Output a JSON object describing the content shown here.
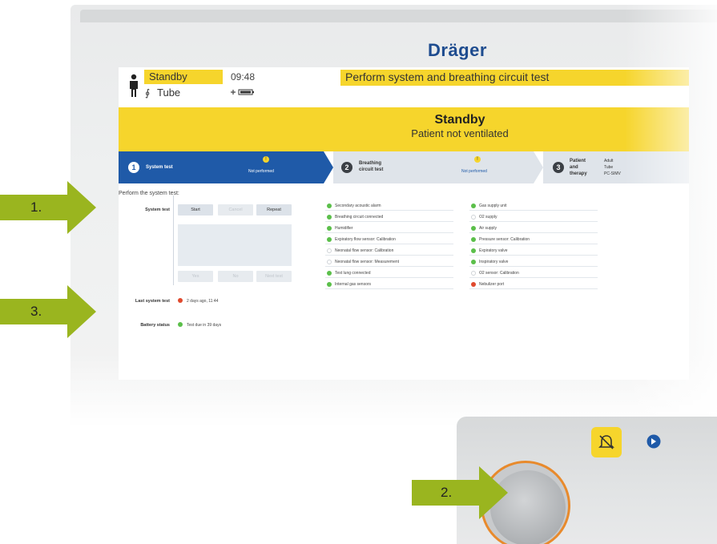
{
  "brand": "Dräger",
  "header": {
    "mode": "Standby",
    "airway": "Tube",
    "time": "09:48",
    "banner": "Perform system and breathing circuit test"
  },
  "status": {
    "title": "Standby",
    "subtitle": "Patient not ventilated"
  },
  "steps": [
    {
      "num": "1",
      "label": "System test",
      "status": "Not performed"
    },
    {
      "num": "2",
      "label": "Breathing circuit test",
      "status": "Not performed"
    },
    {
      "num": "3",
      "label": "Patient and therapy",
      "details": [
        "Adult",
        "Tube",
        "PC-SIMV"
      ]
    }
  ],
  "system_test": {
    "prompt": "Perform the system test:",
    "row_label": "System test",
    "buttons_top": [
      "Start",
      "Cancel",
      "Repeat"
    ],
    "buttons_bottom": [
      "Yes",
      "No",
      "Next test"
    ],
    "last_label": "Last system test",
    "last_value": "2 days ago, 11:44",
    "battery_label": "Battery status",
    "battery_value": "Test due in 39 days"
  },
  "checklist_left": [
    {
      "text": "Secondary acoustic alarm",
      "state": "ok"
    },
    {
      "text": "Breathing circuit connected",
      "state": "ok"
    },
    {
      "text": "Humidifier",
      "state": "ok"
    },
    {
      "text": "Expiratory flow sensor: Calibration",
      "state": "ok"
    },
    {
      "text": "Neonatal flow sensor: Calibration",
      "state": "none"
    },
    {
      "text": "Neonatal flow sensor: Measurement",
      "state": "none"
    },
    {
      "text": "Test lung connected",
      "state": "ok"
    },
    {
      "text": "Internal gas sensors",
      "state": "ok"
    }
  ],
  "checklist_right": [
    {
      "text": "Gas supply unit",
      "state": "ok"
    },
    {
      "text": "O2 supply",
      "state": "none"
    },
    {
      "text": "Air supply",
      "state": "ok"
    },
    {
      "text": "Pressure sensor: Calibration",
      "state": "ok"
    },
    {
      "text": "Expiratory valve",
      "state": "ok"
    },
    {
      "text": "Inspiratory valve",
      "state": "ok"
    },
    {
      "text": "O2 sensor: Calibration",
      "state": "none"
    },
    {
      "text": "Nebulizer port",
      "state": "fail"
    }
  ],
  "callouts": [
    "1.",
    "2.",
    "3."
  ],
  "colors": {
    "accent_yellow": "#f6d52c",
    "step_blue": "#1f5aa8",
    "callout_green": "#9ab51f",
    "ok": "#5bbf4a",
    "fail": "#e04a2e",
    "knob_ring": "#e88a2c"
  }
}
